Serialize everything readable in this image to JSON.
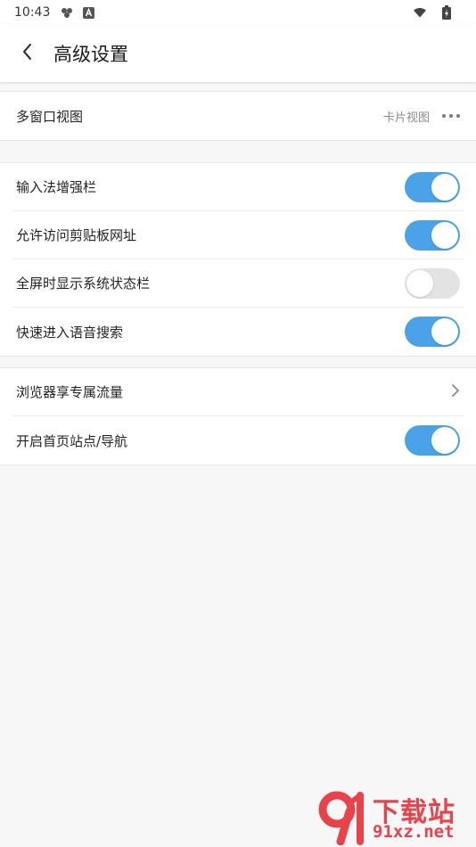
{
  "statusbar": {
    "time": "10:43"
  },
  "header": {
    "title": "高级设置"
  },
  "groups": {
    "view": {
      "row": {
        "label": "多窗口视图",
        "value": "卡片视图"
      }
    },
    "features": {
      "rows": [
        {
          "label": "输入法增强栏",
          "on": true
        },
        {
          "label": "允许访问剪贴板网址",
          "on": true
        },
        {
          "label": "全屏时显示系统状态栏",
          "on": false
        },
        {
          "label": "快速进入语音搜索",
          "on": true
        }
      ]
    },
    "extra": {
      "rows": [
        {
          "label": "浏览器享专属流量"
        },
        {
          "label": "开启首页站点/导航",
          "on": true
        }
      ]
    }
  },
  "watermark": {
    "title": "下载站",
    "url": "91xz.net"
  },
  "colors": {
    "accent": "#4aa3e6",
    "toggle_off": "#e3e3e3",
    "watermark": "#e8434a"
  }
}
